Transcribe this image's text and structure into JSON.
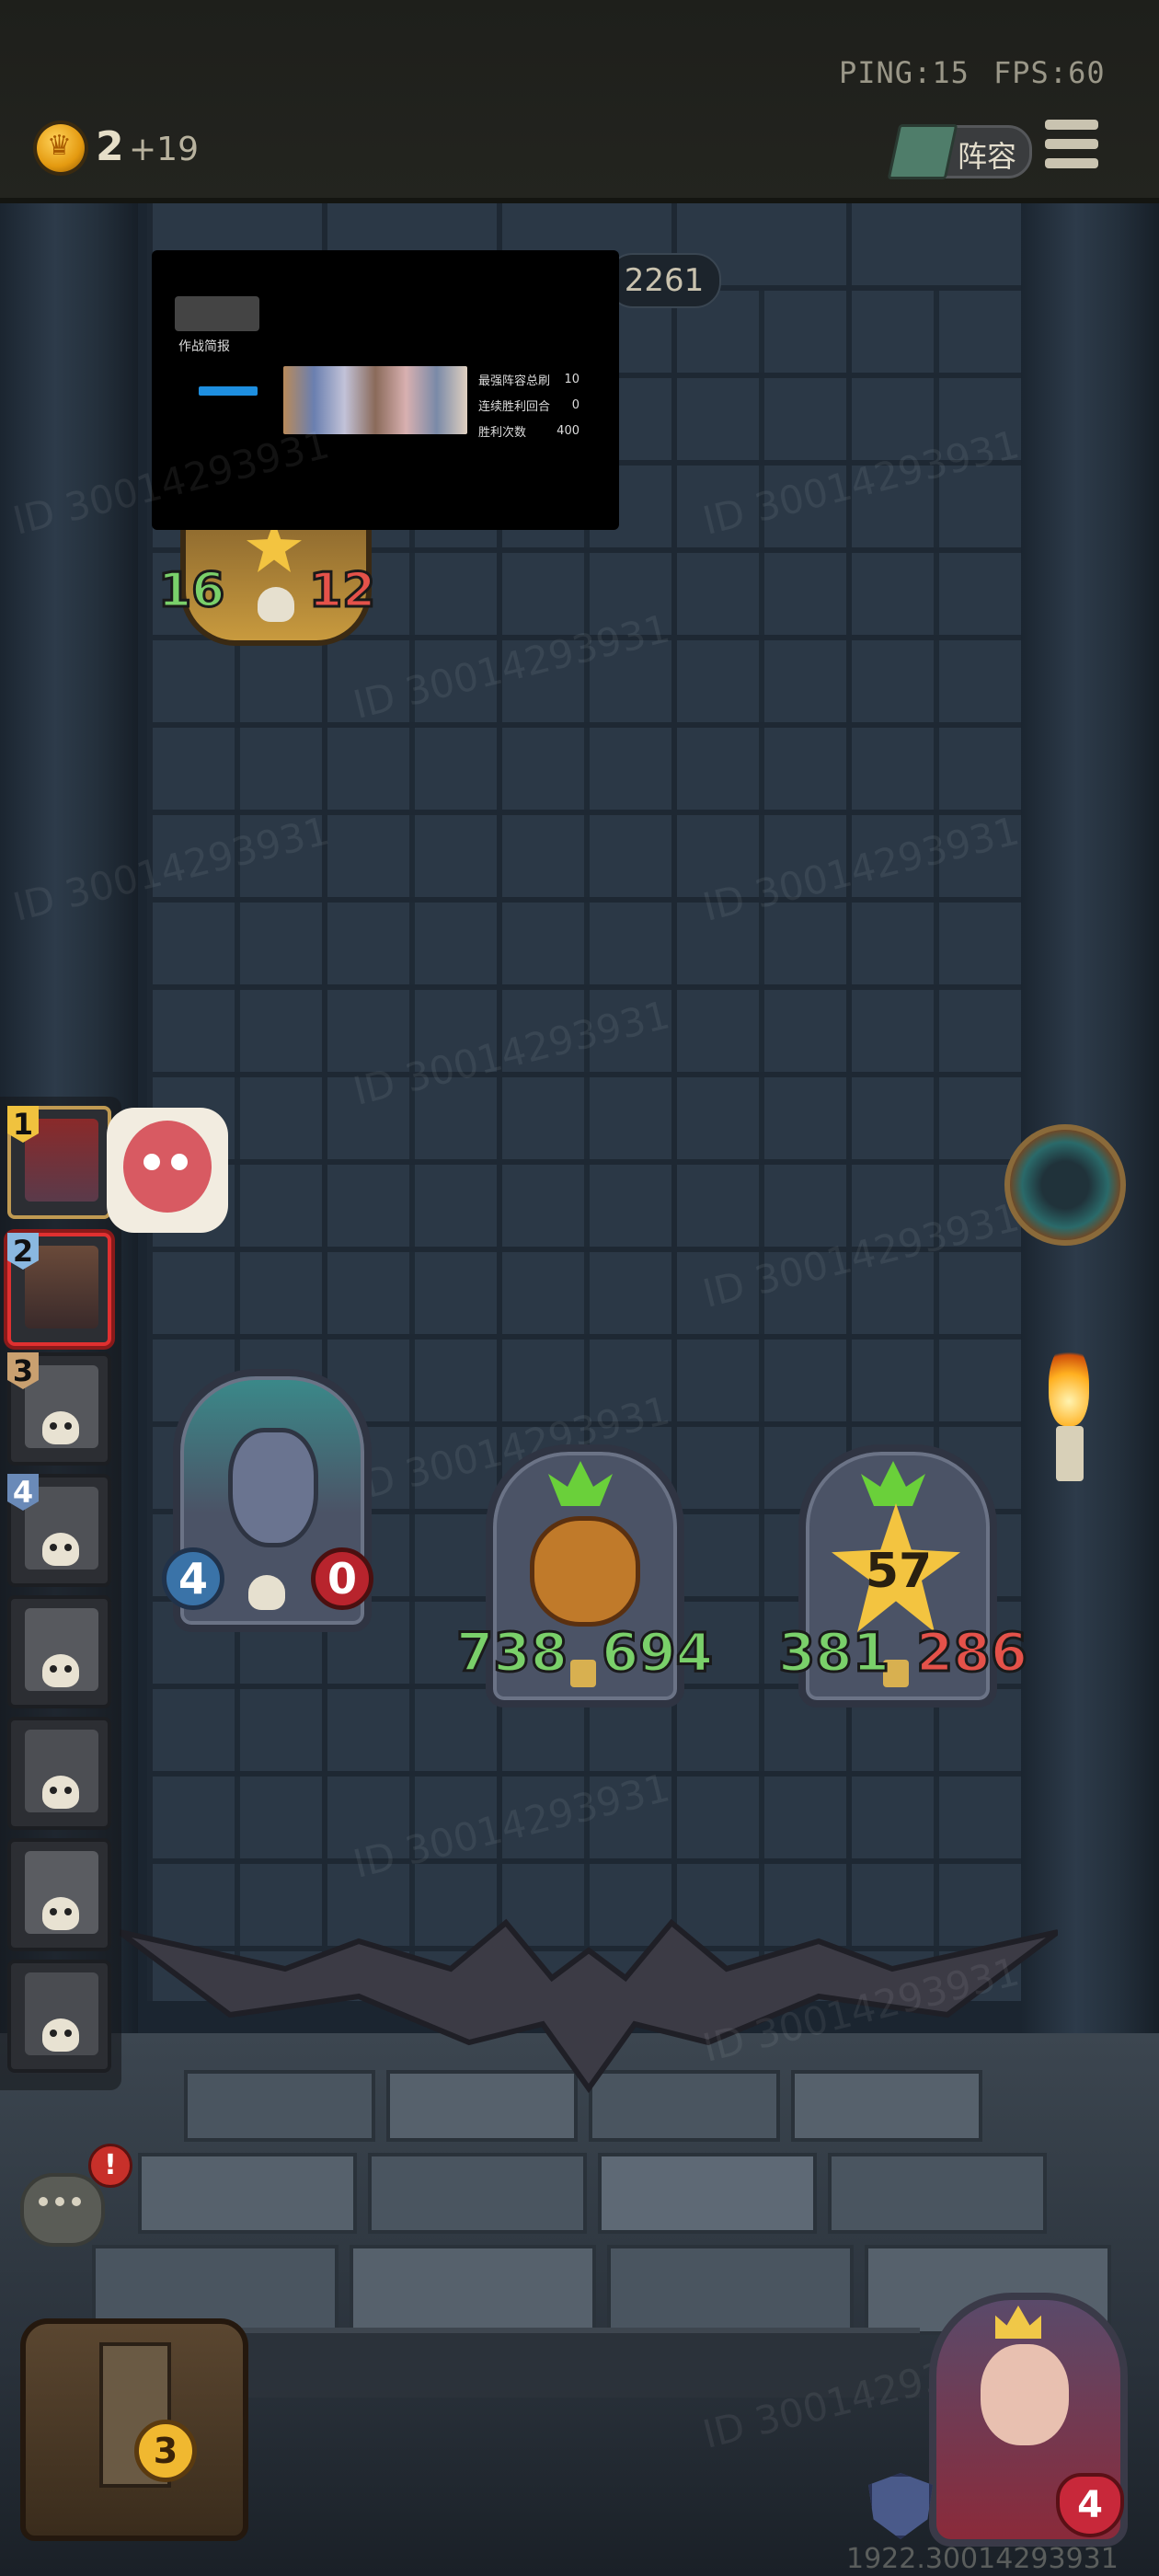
{
  "status": {
    "ping": "PING:15",
    "fps": "FPS:60"
  },
  "resources": {
    "gold": "2",
    "income": "+19"
  },
  "header": {
    "lineup_label": "阵容"
  },
  "opponent_score": "2261",
  "video_overlay": {
    "title": "作战简报",
    "rows": [
      {
        "label": "最强阵容总刷",
        "value": "10"
      },
      {
        "label": "连续胜利回合",
        "value": "0"
      },
      {
        "label": "胜利次数",
        "value": "400"
      }
    ]
  },
  "enemy_hero": {
    "attack": "16",
    "health": "12"
  },
  "board_minions": [
    {
      "name": "potion",
      "attack": "4",
      "health": "0"
    },
    {
      "name": "pumpkin-knight",
      "attack": "738",
      "health": "694"
    },
    {
      "name": "pumpkin-knight-star",
      "star": "57",
      "attack": "381",
      "health": "286"
    }
  ],
  "players": [
    {
      "rank": "1",
      "state": "alive"
    },
    {
      "rank": "2",
      "state": "current"
    },
    {
      "rank": "3",
      "state": "dead"
    },
    {
      "rank": "4",
      "state": "dead"
    },
    {
      "rank": "",
      "state": "dead"
    },
    {
      "rank": "",
      "state": "dead"
    },
    {
      "rank": "",
      "state": "dead"
    },
    {
      "rank": "",
      "state": "dead"
    }
  ],
  "chest_count": "3",
  "player_hero": {
    "health": "4"
  },
  "watermark": "ID 30014293931",
  "footer_id": "1922.30014293931",
  "colors": {
    "gold": "#f2b222",
    "attack_green": "#7ad06a",
    "health_red": "#e4524a",
    "wall": "#2b3846"
  },
  "icons": [
    "coin-icon",
    "lineup-book-icon",
    "menu-icon",
    "chat-icon",
    "alert-icon",
    "portal-icon",
    "torch-icon",
    "shield-icon",
    "chest-icon"
  ]
}
